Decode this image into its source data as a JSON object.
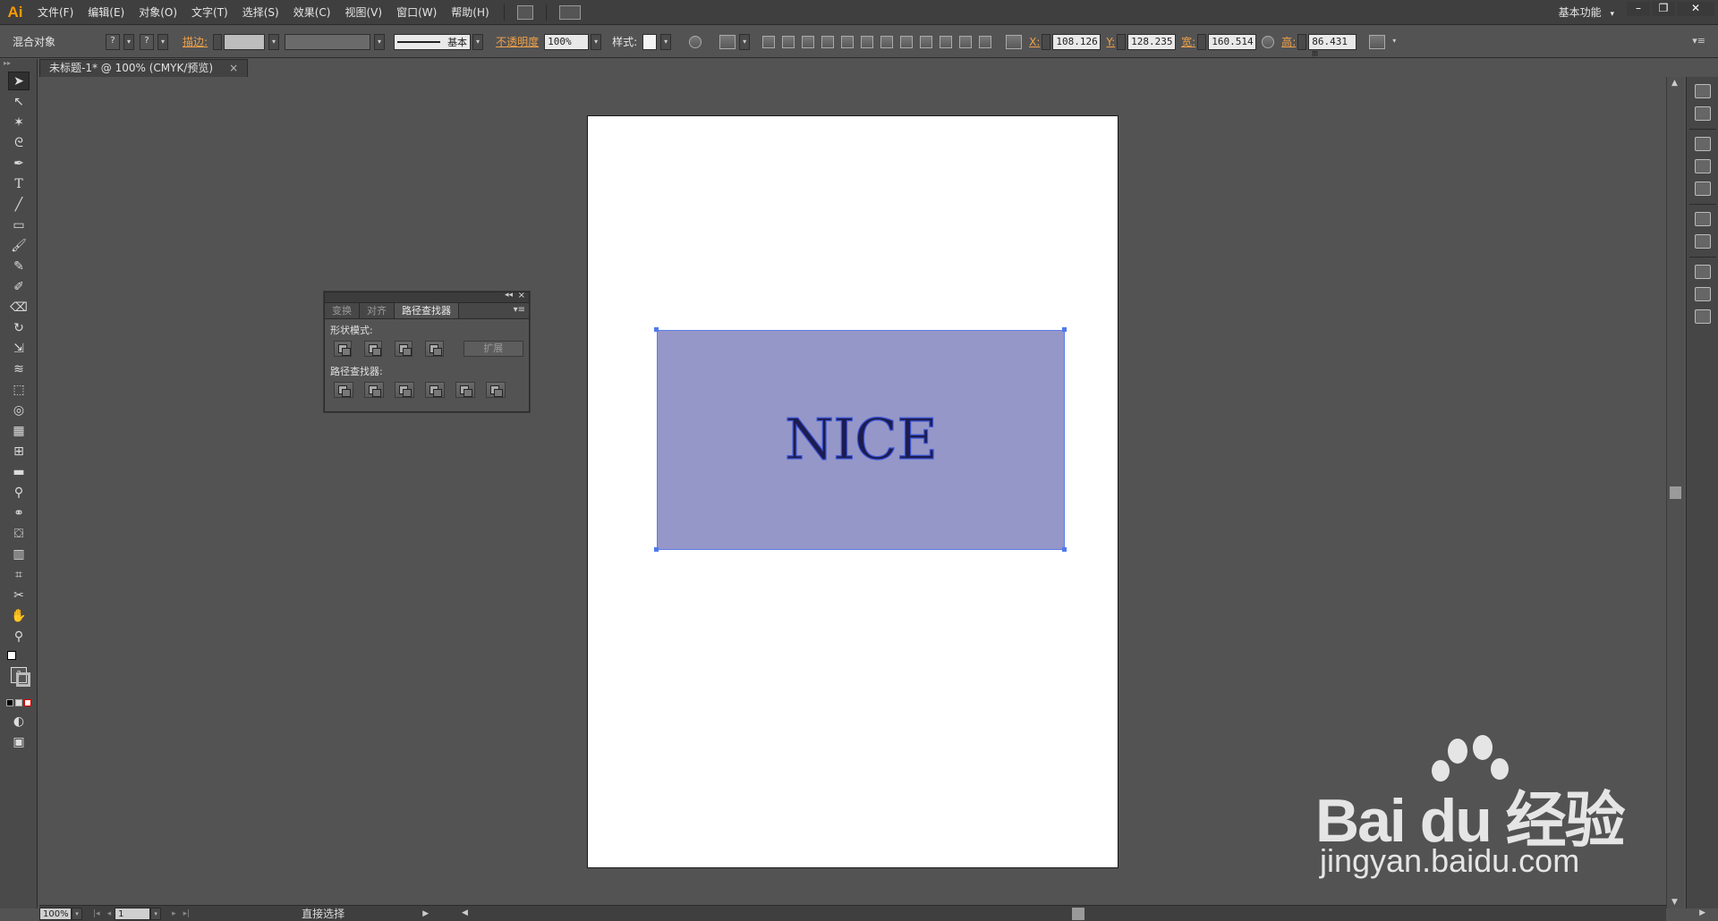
{
  "menubar": {
    "logo": "Ai",
    "items": [
      "文件(F)",
      "编辑(E)",
      "对象(O)",
      "文字(T)",
      "选择(S)",
      "效果(C)",
      "视图(V)",
      "窗口(W)",
      "帮助(H)"
    ],
    "workspace": "基本功能",
    "workspace_arrow": "▾",
    "window_buttons": [
      "–",
      "❐",
      "✕"
    ]
  },
  "controlbar": {
    "selection_label": "混合对象",
    "fill_swatch": "?",
    "stroke_swatch": "?",
    "stroke_label": "描边:",
    "stroke_style_label": "基本",
    "opacity_label": "不透明度",
    "opacity_value": "100%",
    "style_label": "样式:",
    "x_label": "X:",
    "x_value": "108.126",
    "y_label": "Y:",
    "y_value": "128.235",
    "w_label": "宽:",
    "w_value": "160.514",
    "h_label": "高:",
    "h_value": "86.431 m"
  },
  "document": {
    "tab_title": "未标题-1* @ 100% (CMYK/预览)",
    "close": "×"
  },
  "canvas": {
    "text": "NICE",
    "rect_fill": "#9597c8",
    "selection_color": "#4f79ee"
  },
  "pathfinder_panel": {
    "tabs": [
      "变换",
      "对齐",
      "路径查找器"
    ],
    "active_tab": "路径查找器",
    "shape_modes_label": "形状模式:",
    "expand_label": "扩展",
    "pathfinders_label": "路径查找器:",
    "collapse": "◂◂",
    "close": "×",
    "menu": "▾≡"
  },
  "statusbar": {
    "zoom": "100%",
    "artboard_number": "1",
    "status": "直接选择",
    "arrow": "▶"
  },
  "watermark": {
    "logo": "Bai  du 经验",
    "url": "jingyan.baidu.com"
  }
}
